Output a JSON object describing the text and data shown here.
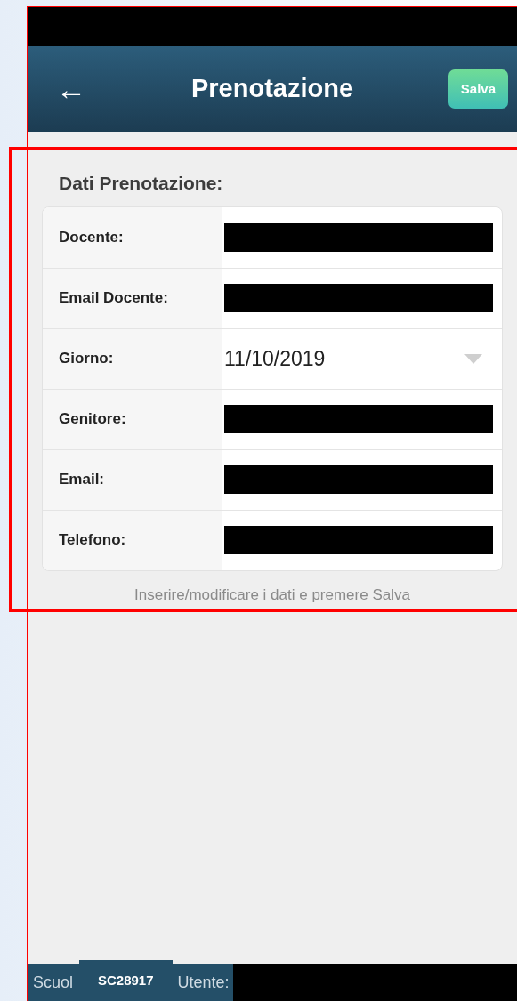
{
  "header": {
    "back_icon": "←",
    "title": "Prenotazione",
    "save_button": "Salva"
  },
  "form": {
    "title": "Dati Prenotazione:",
    "fields": [
      {
        "label": "Docente:",
        "kind": "redacted"
      },
      {
        "label": "Email Docente:",
        "kind": "redacted"
      },
      {
        "label": "Giorno:",
        "kind": "dropdown",
        "value": "11/10/2019"
      },
      {
        "label": "Genitore:",
        "kind": "redacted"
      },
      {
        "label": "Email:",
        "kind": "redacted"
      },
      {
        "label": "Telefono:",
        "kind": "redacted"
      }
    ],
    "hint": "Inserire/modificare i dati e premere Salva"
  },
  "status_bar": {
    "school_label": "Scuol",
    "school_code": "SC28917",
    "user_label": "Utente:"
  }
}
